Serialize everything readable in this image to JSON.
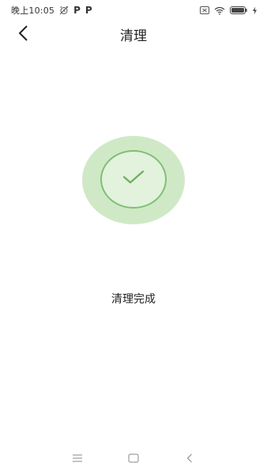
{
  "status_bar": {
    "time": "晚上10:05",
    "app_icons": [
      "P",
      "P"
    ],
    "icons": [
      "alarm-icon",
      "p-app-icon",
      "p-app-icon",
      "sim-icon",
      "wifi-icon",
      "battery-icon",
      "charging-icon"
    ]
  },
  "nav": {
    "title": "清理",
    "back_icon": "chevron-left-icon"
  },
  "result": {
    "message": "清理完成",
    "icon": "check-icon"
  },
  "colors": {
    "halo": "#cfe9c6",
    "ring": "#7fbf73",
    "check": "#6ab05c"
  },
  "system_nav": {
    "icons": [
      "menu-icon",
      "home-icon",
      "back-icon"
    ]
  }
}
